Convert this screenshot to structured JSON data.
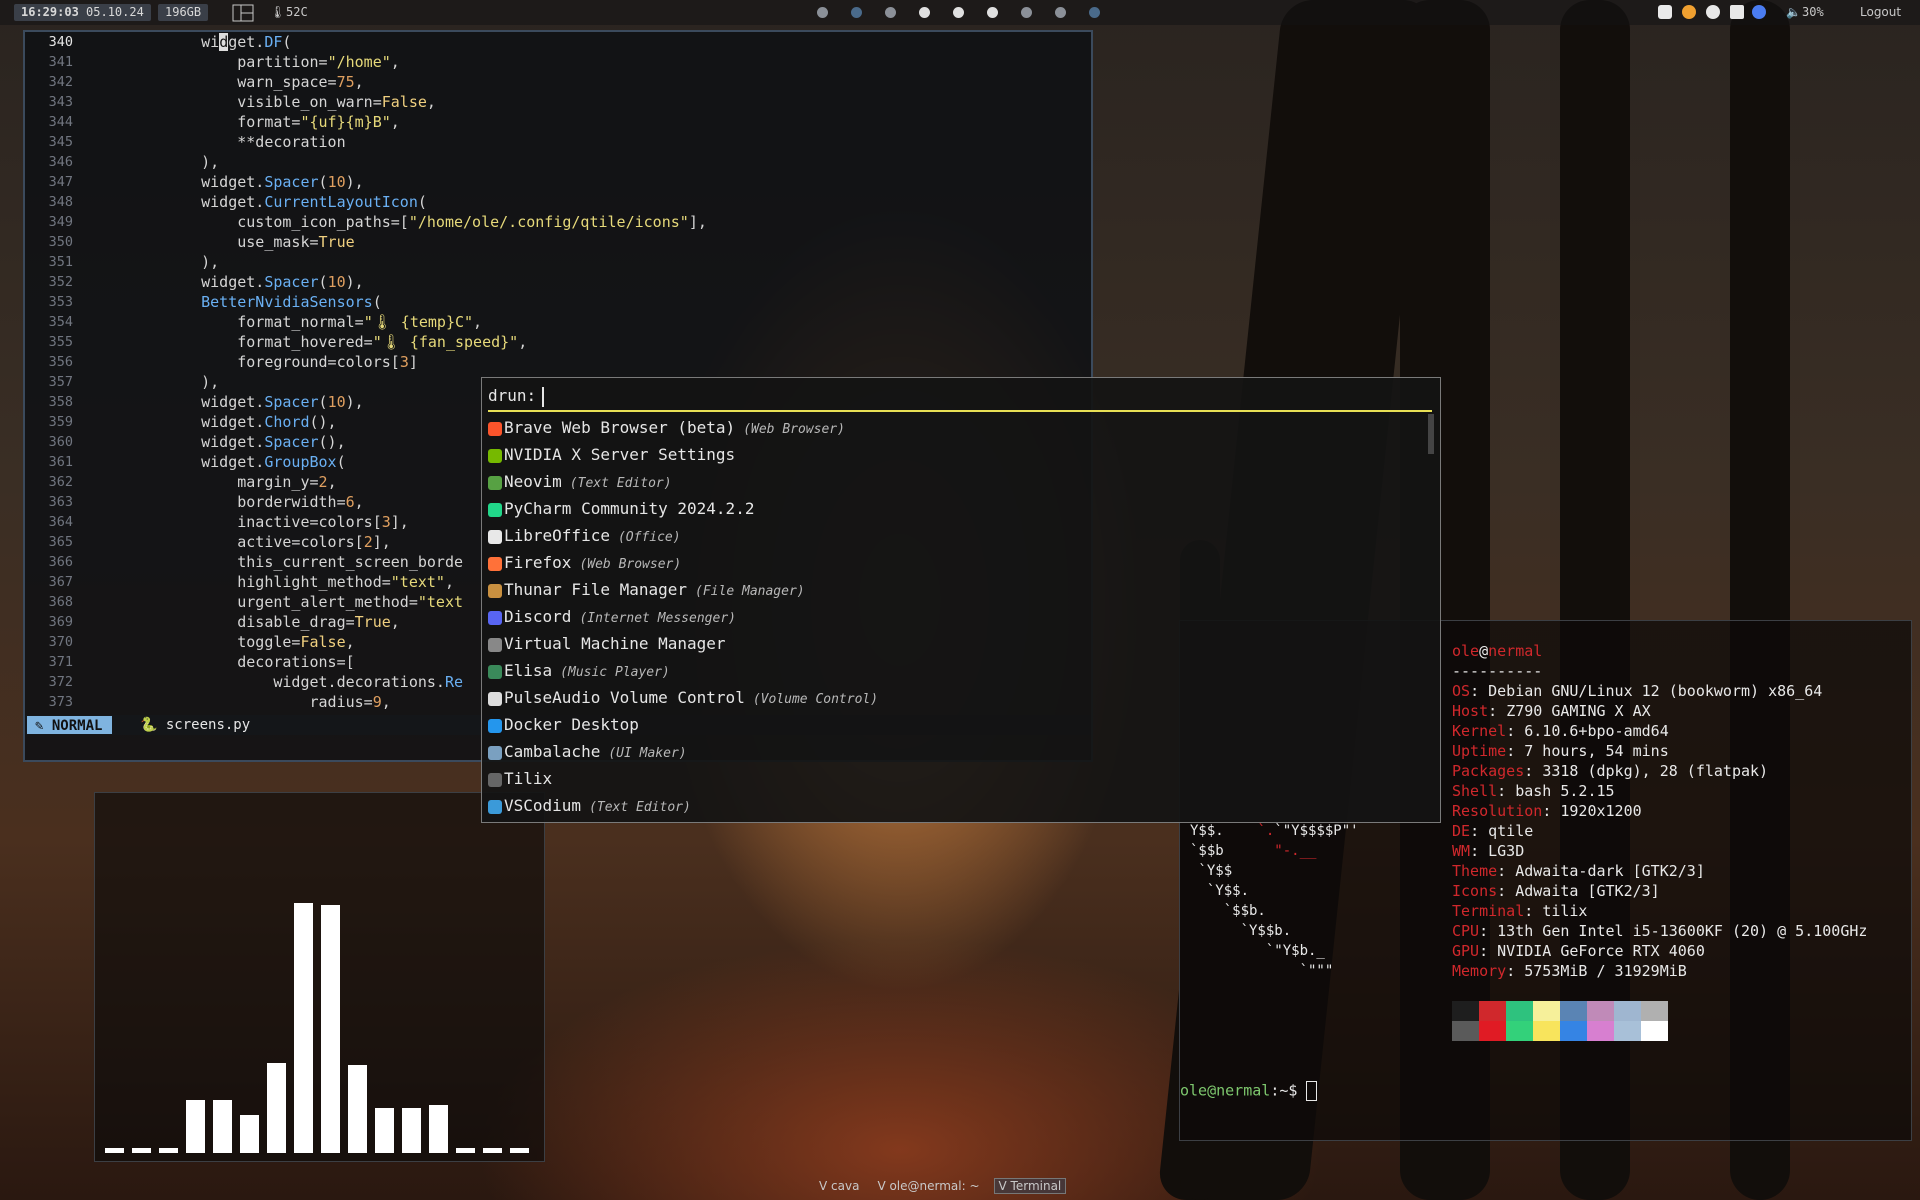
{
  "topbar": {
    "clock": "16:29:03",
    "date": "05.10.24",
    "disk": "196GB",
    "temp": "52C",
    "volume": "30%",
    "logout": "Logout"
  },
  "editor": {
    "lines": [
      "340",
      "341",
      "342",
      "343",
      "344",
      "345",
      "346",
      "347",
      "348",
      "349",
      "350",
      "351",
      "352",
      "353",
      "354",
      "355",
      "356",
      "357",
      "358",
      "359",
      "360",
      "361",
      "362",
      "363",
      "364",
      "365",
      "366",
      "367",
      "368",
      "369",
      "370",
      "371",
      "372",
      "373"
    ],
    "mode": "NORMAL",
    "filename": "screens.py"
  },
  "launcher": {
    "prompt": "drun:",
    "items": [
      {
        "name": "Brave Web Browser (beta)",
        "generic": "(Web Browser)",
        "icon": "brave-icon"
      },
      {
        "name": "NVIDIA X Server Settings",
        "generic": "",
        "icon": "nvidia-icon"
      },
      {
        "name": "Neovim",
        "generic": "(Text Editor)",
        "icon": "neovim-icon"
      },
      {
        "name": "PyCharm Community 2024.2.2",
        "generic": "",
        "icon": "pycharm-icon"
      },
      {
        "name": "LibreOffice",
        "generic": "(Office)",
        "icon": "libreoffice-icon"
      },
      {
        "name": "Firefox",
        "generic": "(Web Browser)",
        "icon": "firefox-icon"
      },
      {
        "name": "Thunar File Manager",
        "generic": "(File Manager)",
        "icon": "thunar-icon"
      },
      {
        "name": "Discord",
        "generic": "(Internet Messenger)",
        "icon": "discord-icon"
      },
      {
        "name": "Virtual Machine Manager",
        "generic": "",
        "icon": "vm-icon"
      },
      {
        "name": "Elisa",
        "generic": "(Music Player)",
        "icon": "elisa-icon"
      },
      {
        "name": "PulseAudio Volume Control",
        "generic": "(Volume Control)",
        "icon": "pulseaudio-icon"
      },
      {
        "name": "Docker Desktop",
        "generic": "",
        "icon": "docker-icon"
      },
      {
        "name": "Cambalache",
        "generic": "(UI Maker)",
        "icon": "cambalache-icon"
      },
      {
        "name": "Tilix",
        "generic": "",
        "icon": "tilix-icon"
      },
      {
        "name": "VSCodium",
        "generic": "(Text Editor)",
        "icon": "vscodium-icon"
      }
    ]
  },
  "neofetch": {
    "user": "ole",
    "host": "nermal",
    "separator": "----------",
    "rows": [
      {
        "label": "OS",
        "value": "Debian GNU/Linux 12 (bookworm) x86_64"
      },
      {
        "label": "Host",
        "value": "Z790 GAMING X AX"
      },
      {
        "label": "Kernel",
        "value": "6.10.6+bpo-amd64"
      },
      {
        "label": "Uptime",
        "value": "7 hours, 54 mins"
      },
      {
        "label": "Packages",
        "value": "3318 (dpkg), 28 (flatpak)"
      },
      {
        "label": "Shell",
        "value": "bash 5.2.15"
      },
      {
        "label": "Resolution",
        "value": "1920x1200"
      },
      {
        "label": "DE",
        "value": "qtile"
      },
      {
        "label": "WM",
        "value": "LG3D"
      },
      {
        "label": "Theme",
        "value": "Adwaita-dark [GTK2/3]"
      },
      {
        "label": "Icons",
        "value": "Adwaita [GTK2/3]"
      },
      {
        "label": "Terminal",
        "value": "tilix"
      },
      {
        "label": "CPU",
        "value": "13th Gen Intel i5-13600KF (20) @ 5.100GHz"
      },
      {
        "label": "GPU",
        "value": "NVIDIA GeForce RTX 4060"
      },
      {
        "label": "Memory",
        "value": "5753MiB / 31929MiB"
      }
    ],
    "palette_top": [
      "#1e1e1e",
      "#d0282c",
      "#2ec27e",
      "#f6f09a",
      "#5a84b4",
      "#c08ab8",
      "#9fb6d0",
      "#b0b0b0"
    ],
    "palette_bottom": [
      "#5a5a5a",
      "#e01b24",
      "#33d17a",
      "#f8e45c",
      "#3584e4",
      "#d77fd0",
      "#a8c0d8",
      "#ffffff"
    ],
    "prompt_user": "ole@nermal",
    "prompt_path": ":~$"
  },
  "cava": {
    "levels": [
      0.02,
      0.02,
      0.02,
      0.21,
      0.21,
      0.15,
      0.36,
      1.0,
      0.99,
      0.35,
      0.18,
      0.18,
      0.19,
      0.02,
      0.02,
      0.02
    ]
  },
  "taskbar": {
    "tasks": [
      "V cava",
      "V ole@nermal: ~",
      "V Terminal"
    ]
  }
}
